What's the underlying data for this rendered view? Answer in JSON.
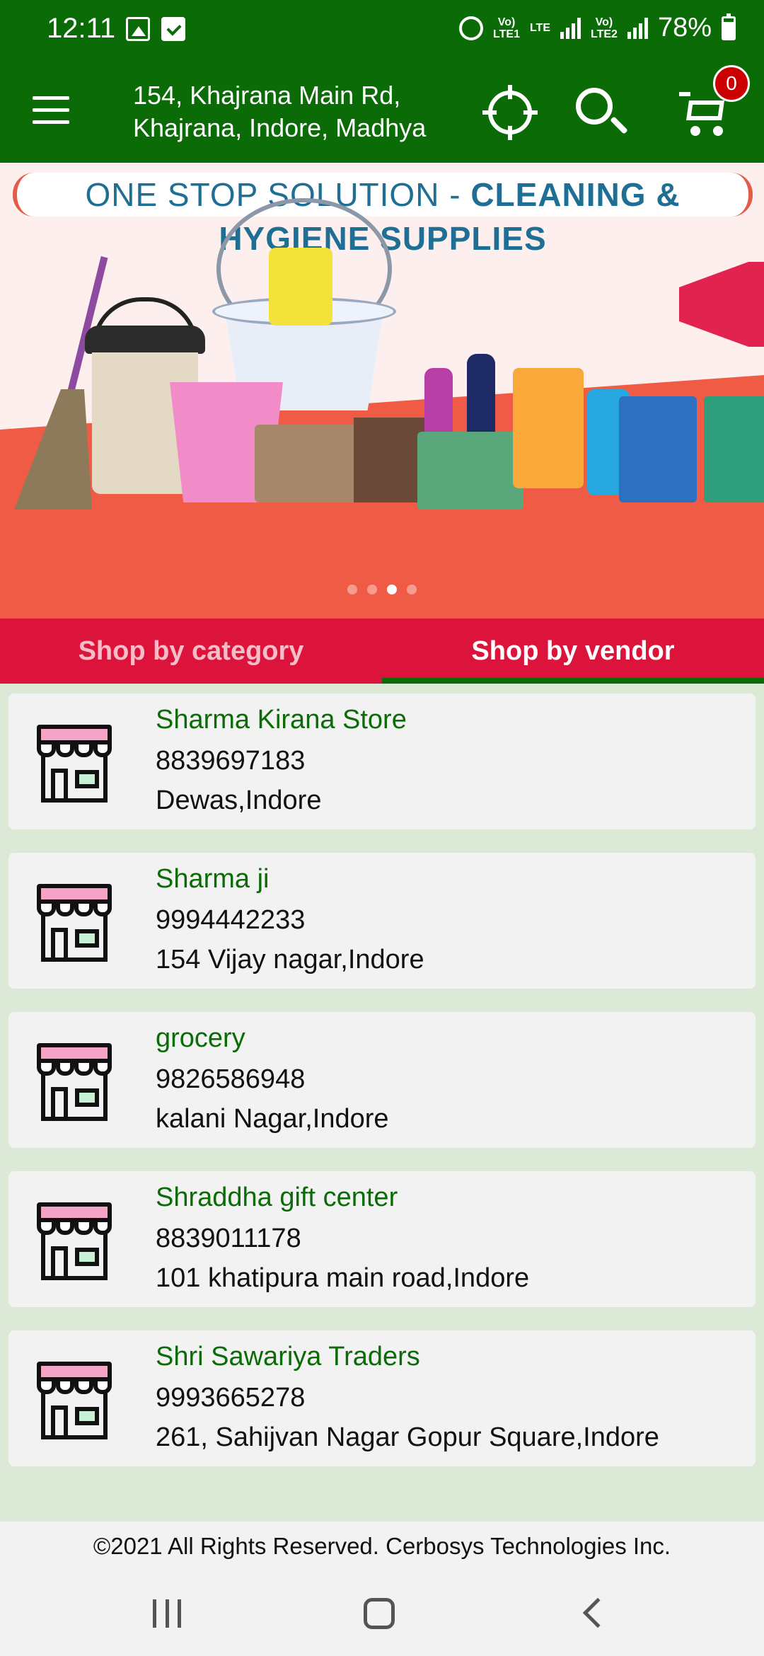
{
  "status_bar": {
    "time": "12:11",
    "net1_top": "Vo)",
    "net1_bottom": "LTE1",
    "lte_label": "LTE",
    "net2_top": "Vo)",
    "net2_bottom": "LTE2",
    "battery": "78%",
    "icons": [
      "image-icon",
      "check-icon",
      "alarm-icon",
      "signal-icon",
      "battery-icon"
    ]
  },
  "app_bar": {
    "address_line1": "154, Khajrana Main Rd,",
    "address_line2": "Khajrana, Indore, Madhya",
    "cart_count": "0",
    "icons": [
      "menu-icon",
      "locate-icon",
      "search-icon",
      "cart-icon"
    ]
  },
  "banner": {
    "headline_left": "ONE STOP SOLUTION - ",
    "headline_right": "CLEANING & HYGIENE SUPPLIES",
    "slide_count": 4,
    "active_slide": 3
  },
  "tabs": [
    {
      "label": "Shop by category",
      "active": false
    },
    {
      "label": "Shop by vendor",
      "active": true
    }
  ],
  "vendors": [
    {
      "name": "Sharma Kirana Store",
      "phone": "8839697183",
      "address": "Dewas,Indore"
    },
    {
      "name": "Sharma ji",
      "phone": "9994442233",
      "address": "154 Vijay nagar,Indore"
    },
    {
      "name": "grocery",
      "phone": "9826586948",
      "address": "kalani Nagar,Indore"
    },
    {
      "name": "Shraddha gift center",
      "phone": "8839011178",
      "address": "101 khatipura main road,Indore"
    },
    {
      "name": "Shri Sawariya Traders",
      "phone": "9993665278",
      "address": "261, Sahijvan Nagar Gopur Square,Indore"
    }
  ],
  "footer": {
    "copyright": "©2021 All Rights Reserved. Cerbosys Technologies Inc."
  },
  "colors": {
    "brand_green": "#0a6b07",
    "tab_red": "#dc143c",
    "badge_red": "#cc0000",
    "background": "#dbe9d6"
  }
}
